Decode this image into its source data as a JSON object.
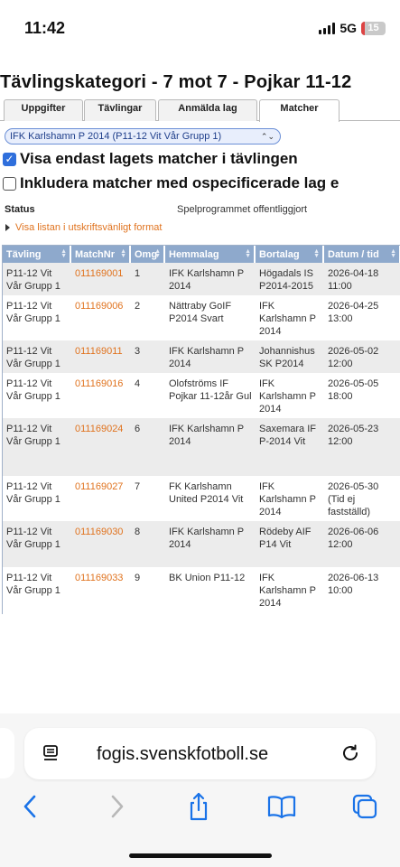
{
  "status_bar": {
    "time": "11:42",
    "network": "5G",
    "battery": "15",
    "battery_level": 0.15,
    "colors": {
      "battery_low": "#dd4444"
    }
  },
  "page": {
    "title": "Tävlingskategori - 7 mot 7 - Pojkar 11-12",
    "tabs": [
      {
        "label": "Uppgifter",
        "active": false
      },
      {
        "label": "Tävlingar",
        "active": false
      },
      {
        "label": "Anmälda lag",
        "active": false
      },
      {
        "label": "Matcher",
        "active": true
      }
    ],
    "team_select": {
      "selected": "IFK Karlshamn P 2014 (P11-12 Vit Vår Grupp 1)"
    },
    "checkbox_team_only": {
      "label": "Visa endast lagets matcher i tävlingen",
      "checked": true
    },
    "checkbox_unspecified": {
      "label": "Inkludera matcher med ospecificerade lag e",
      "checked": false
    },
    "status": {
      "label": "Status",
      "value": "Spelprogrammet offentliggjort"
    },
    "print_link": "Visa listan i utskriftsvänligt format",
    "colors": {
      "header": "#8ea9cc",
      "link": "#e0731f",
      "row_alt": "#ececec"
    }
  },
  "table": {
    "headers": [
      "Tävling",
      "MatchNr",
      "Omg",
      "Hemmalag",
      "Bortalag",
      "Datum / tid"
    ],
    "rows": [
      {
        "tavling": "P11-12 Vit Vår Grupp 1",
        "matchnr": "011169001",
        "omg": "1",
        "hemmalag": "IFK Karlshamn P 2014",
        "bortalag": "Högadals IS P2014-2015",
        "datum": "2026-04-18 11:00"
      },
      {
        "tavling": "P11-12 Vit Vår Grupp 1",
        "matchnr": "011169006",
        "omg": "2",
        "hemmalag": "Nättraby GoIF P2014 Svart",
        "bortalag": "IFK Karlshamn P 2014",
        "datum": "2026-04-25 13:00"
      },
      {
        "tavling": "P11-12 Vit Vår Grupp 1",
        "matchnr": "011169011",
        "omg": "3",
        "hemmalag": "IFK Karlshamn P 2014",
        "bortalag": "Johannishus SK P2014",
        "datum": "2026-05-02 12:00"
      },
      {
        "tavling": "P11-12 Vit Vår Grupp 1",
        "matchnr": "011169016",
        "omg": "4",
        "hemmalag": "Olofströms IF Pojkar 11-12år Gul",
        "bortalag": "IFK Karlshamn P 2014",
        "datum": "2026-05-05 18:00"
      },
      {
        "tavling": "P11-12 Vit Vår Grupp 1",
        "matchnr": "011169024",
        "omg": "6",
        "hemmalag": "IFK Karlshamn P 2014",
        "bortalag": "Saxemara IF P-2014 Vit",
        "datum": "2026-05-23 12:00"
      },
      {
        "tavling": "P11-12 Vit Vår Grupp 1",
        "matchnr": "011169027",
        "omg": "7",
        "hemmalag": "FK Karlshamn United P2014 Vit",
        "bortalag": "IFK Karlshamn P 2014",
        "datum": "2026-05-30 (Tid ej fastställd)"
      },
      {
        "tavling": "P11-12 Vit Vår Grupp 1",
        "matchnr": "011169030",
        "omg": "8",
        "hemmalag": "IFK Karlshamn P 2014",
        "bortalag": "Rödeby AIF P14 Vit",
        "datum": "2026-06-06 12:00"
      },
      {
        "tavling": "P11-12 Vit Vår Grupp 1",
        "matchnr": "011169033",
        "omg": "9",
        "hemmalag": "BK Union P11-12",
        "bortalag": "IFK Karlshamn P 2014",
        "datum": "2026-06-13 10:00"
      }
    ]
  },
  "browser": {
    "url": "fogis.svenskfotboll.se",
    "icons": {
      "reader": "reader-icon",
      "reload": "reload-icon",
      "back": "back-icon",
      "forward": "forward-icon",
      "share": "share-icon",
      "bookmarks": "bookmarks-icon",
      "tabs": "tabs-icon"
    },
    "colors": {
      "accent": "#1a73e8"
    }
  }
}
